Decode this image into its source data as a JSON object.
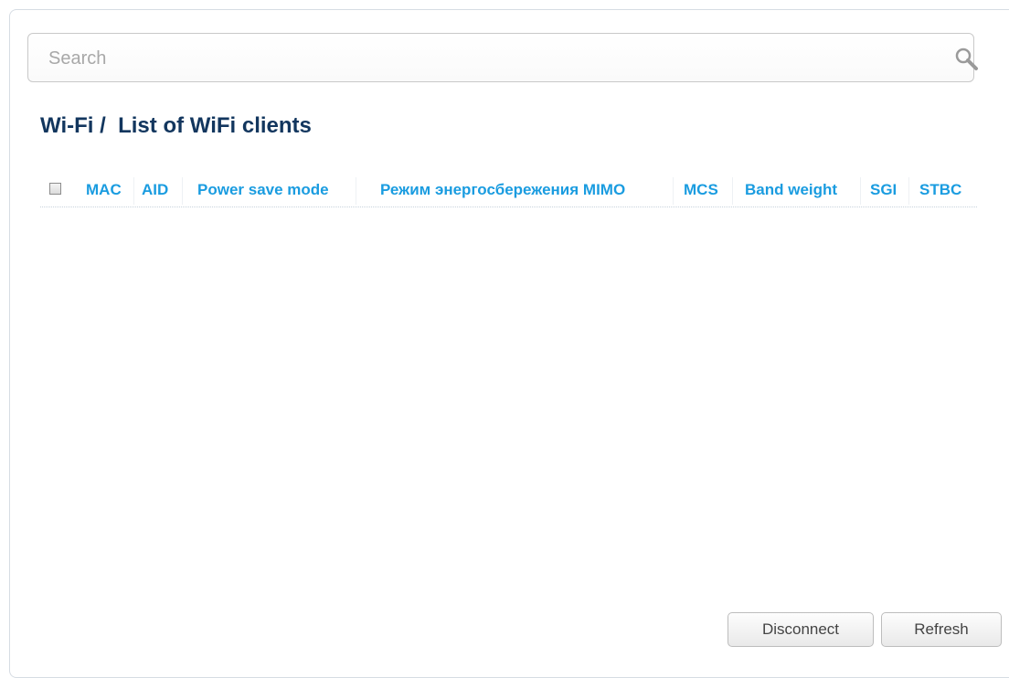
{
  "search": {
    "placeholder": "Search",
    "value": ""
  },
  "page": {
    "title": "Wi-Fi /  List of WiFi clients"
  },
  "table": {
    "columns": [
      "MAC",
      "AID",
      "Power save mode",
      "Режим энергосбережения MIMO",
      "MCS",
      "Band weight",
      "SGI",
      "STBC"
    ],
    "rows": []
  },
  "actions": {
    "disconnect_label": "Disconnect",
    "refresh_label": "Refresh"
  },
  "colors": {
    "title": "#12365e",
    "column_header": "#1a9ce0"
  }
}
